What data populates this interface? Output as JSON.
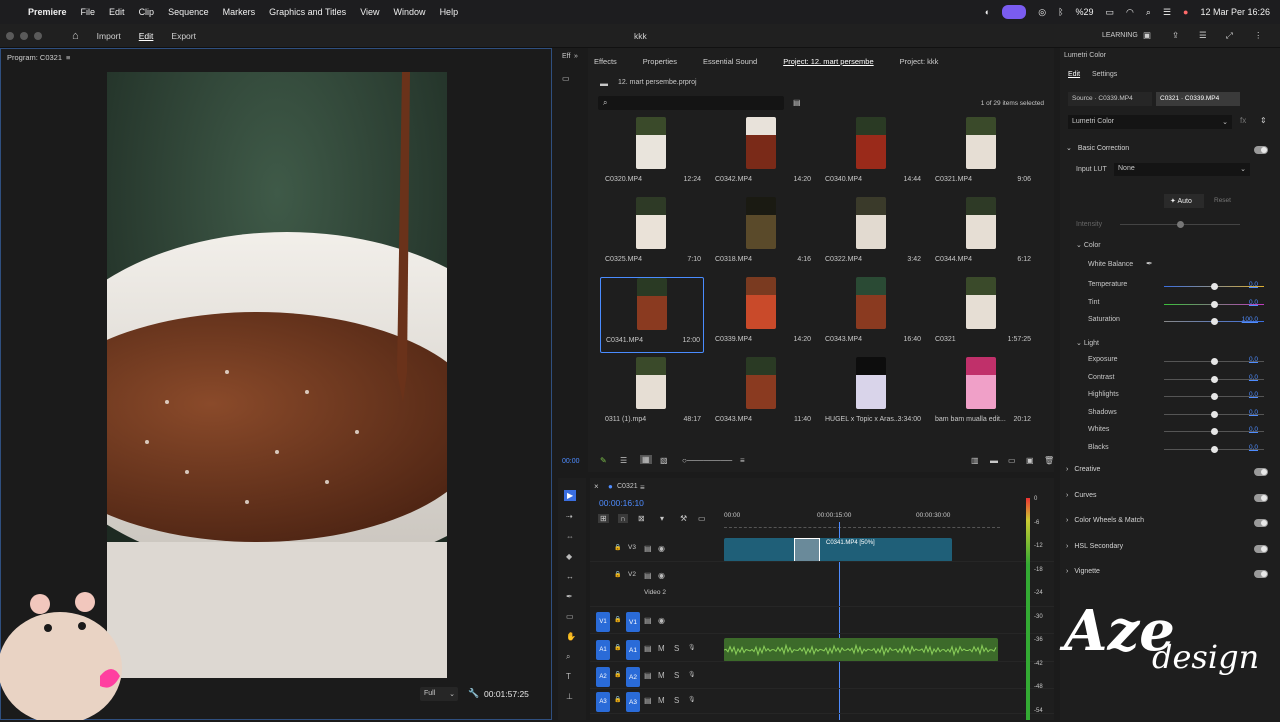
{
  "menubar": {
    "app": "Premiere",
    "items": [
      "File",
      "Edit",
      "Clip",
      "Sequence",
      "Markers",
      "Graphics and Titles",
      "View",
      "Window",
      "Help"
    ],
    "battery": "%29",
    "datetime": "12 Mar Per 16:26"
  },
  "appbar": {
    "tabs": [
      "Import",
      "Edit",
      "Export"
    ],
    "title": "kkk",
    "workspace": "LEARNING"
  },
  "program": {
    "title": "Program: C0321",
    "zoom": "Full",
    "timecode": "00:01:57:25"
  },
  "project": {
    "tabs": [
      "Effects",
      "Properties",
      "Essential Sound",
      "Project: 12. mart persembe",
      "Project: kkk"
    ],
    "file": "12. mart persembe.prproj",
    "selection": "1 of 29 items selected",
    "items": [
      {
        "name": "C0320.MP4",
        "dur": "12:24",
        "c1": "#3a4a2a",
        "c2": "#e9e4dc"
      },
      {
        "name": "C0342.MP4",
        "dur": "14:20",
        "c1": "#e8e2da",
        "c2": "#7a2a18"
      },
      {
        "name": "C0340.MP4",
        "dur": "14:44",
        "c1": "#2a3a24",
        "c2": "#9a2a1a"
      },
      {
        "name": "C0321.MP4",
        "dur": "9:06",
        "c1": "#3a4a2a",
        "c2": "#e6ded4"
      },
      {
        "name": "C0325.MP4",
        "dur": "7:10",
        "c1": "#2e3a26",
        "c2": "#eae2d8"
      },
      {
        "name": "C0318.MP4",
        "dur": "4:16",
        "c1": "#1a1a12",
        "c2": "#5a4a2a"
      },
      {
        "name": "C0322.MP4",
        "dur": "3:42",
        "c1": "#3a3a2a",
        "c2": "#e2dad0"
      },
      {
        "name": "C0344.MP4",
        "dur": "6:12",
        "c1": "#2e3a26",
        "c2": "#e6ded4"
      },
      {
        "name": "C0341.MP4",
        "dur": "12:00",
        "c1": "#2a3a24",
        "c2": "#8a3a20"
      },
      {
        "name": "C0339.MP4",
        "dur": "14:20",
        "c1": "#7a3a20",
        "c2": "#c94a2a"
      },
      {
        "name": "C0343.MP4",
        "dur": "16:40",
        "c1": "#2a4a34",
        "c2": "#8a3a20"
      },
      {
        "name": "C0321",
        "dur": "1:57:25",
        "c1": "#3a4a2a",
        "c2": "#e6ded4"
      },
      {
        "name": "0311 (1).mp4",
        "dur": "48:17",
        "c1": "#3a4a2a",
        "c2": "#e6ded4"
      },
      {
        "name": "C0343.MP4",
        "dur": "11:40",
        "c1": "#2a3a24",
        "c2": "#8a3a20"
      },
      {
        "name": "HUGEL x Topic x Aras...",
        "dur": "3:34:00",
        "c1": "#0d0d0d",
        "c2": "#d9d4ea"
      },
      {
        "name": "bam bam mualla edit...",
        "dur": "20:12",
        "c1": "#c0306a",
        "c2": "#f0a0c8"
      }
    ]
  },
  "lumetri": {
    "title": "Lumetri Color",
    "tabs": [
      "Edit",
      "Settings"
    ],
    "source": "Source · C0339.MP4",
    "target": "C0321 · C0339.MP4",
    "effect": "Lumetri Color",
    "basic": "Basic Correction",
    "inputLut": "Input LUT",
    "lutValue": "None",
    "auto": "Auto",
    "reset": "Reset",
    "intensity": "Intensity",
    "color": "Color",
    "wb": "White Balance",
    "colorRows": [
      {
        "label": "Temperature",
        "value": "0,0",
        "pos": 0.5
      },
      {
        "label": "Tint",
        "value": "0,0",
        "pos": 0.5
      },
      {
        "label": "Saturation",
        "value": "100,0",
        "pos": 0.5
      }
    ],
    "light": "Light",
    "lightRows": [
      {
        "label": "Exposure",
        "value": "0,0",
        "pos": 0.5
      },
      {
        "label": "Contrast",
        "value": "0,0",
        "pos": 0.5
      },
      {
        "label": "Highlights",
        "value": "0,0",
        "pos": 0.5
      },
      {
        "label": "Shadows",
        "value": "0,0",
        "pos": 0.5
      },
      {
        "label": "Whites",
        "value": "0,0",
        "pos": 0.5
      },
      {
        "label": "Blacks",
        "value": "0,0",
        "pos": 0.5
      }
    ],
    "sections": [
      "Creative",
      "Curves",
      "Color Wheels & Match",
      "HSL Secondary",
      "Vignette"
    ]
  },
  "timeline": {
    "seq": "C0321",
    "timecode": "00:00:16:10",
    "ruler": [
      "00:00",
      "00:00:15:00",
      "00:00:30:00"
    ],
    "clip": "C0341.MP4 [50%]",
    "v2name": "Video 2",
    "tracks": [
      "V3",
      "V2",
      "V1",
      "A1",
      "A2",
      "A3"
    ],
    "meter": [
      "0",
      "-6",
      "-12",
      "-18",
      "-24",
      "-30",
      "-36",
      "-42",
      "-48",
      "-54"
    ]
  },
  "watermark": {
    "brand1": "Aze",
    "brand2": "design"
  },
  "colors": {
    "accent": "#4e8cff",
    "audio": "#7cc04a",
    "clip": "#1f5f78"
  }
}
